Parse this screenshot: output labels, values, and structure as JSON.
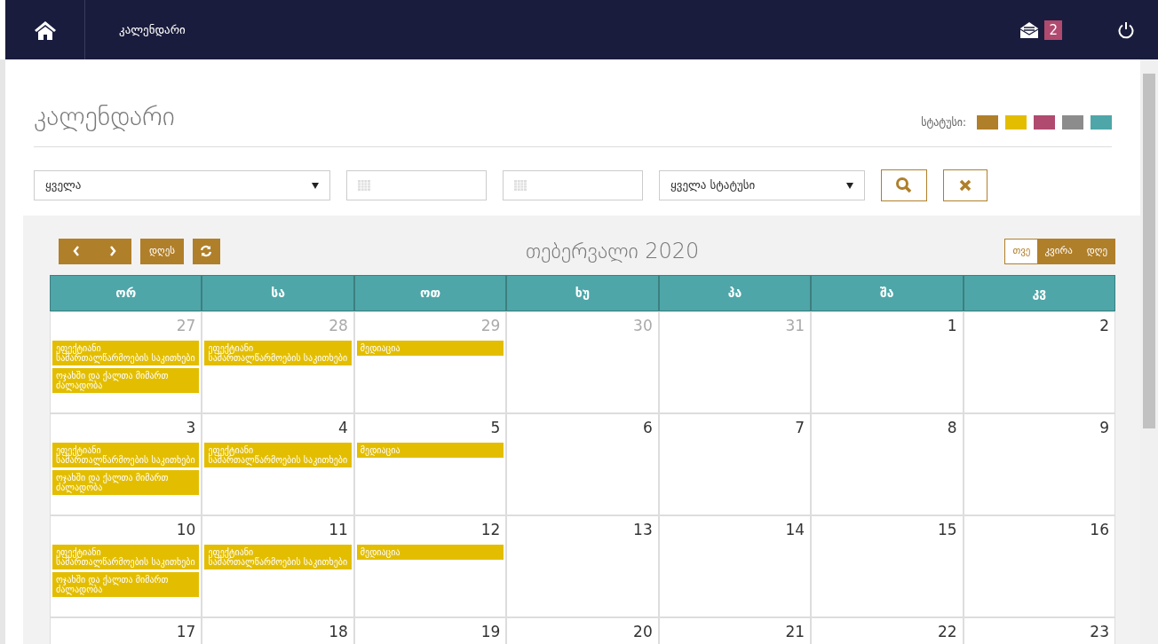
{
  "topbar": {
    "breadcrumb": "კალენდარი",
    "badge": "2"
  },
  "page_title": "კალენდარი",
  "status_legend": {
    "label": "სტატუსი:",
    "colors": [
      {
        "color": "#b07f2a"
      },
      {
        "color": "#e3be00"
      },
      {
        "color": "#b04a6e"
      },
      {
        "color": "#8c8c8c"
      },
      {
        "color": "#4ea6a8"
      }
    ]
  },
  "filters": {
    "category": "ყველა",
    "status": "ყველა სტატუსი"
  },
  "toolbar": {
    "today": "დღეს",
    "month_title": "თებერვალი 2020",
    "views": [
      {
        "label": "თვე",
        "selected": true
      },
      {
        "label": "კვირა",
        "selected": false
      },
      {
        "label": "დღე",
        "selected": false
      }
    ]
  },
  "weekdays": [
    "ორ",
    "სა",
    "ოთ",
    "ხუ",
    "პა",
    "შა",
    "კვ"
  ],
  "weeks": [
    {
      "days": [
        {
          "number": "27",
          "other_month": true,
          "events": [
            {
              "title": "ეფექტიანი სამართალწარმოების საკითხები",
              "color": "#e3be00"
            },
            {
              "title": "ოჯახში და ქალთა მიმართ ძალადობა",
              "color": "#e3be00"
            }
          ]
        },
        {
          "number": "28",
          "other_month": true,
          "events": [
            {
              "title": "ეფექტიანი სამართალწარმოების საკითხები",
              "color": "#e3be00"
            }
          ]
        },
        {
          "number": "29",
          "other_month": true,
          "events": [
            {
              "title": "მედიაცია",
              "color": "#e3be00"
            }
          ]
        },
        {
          "number": "30",
          "other_month": true
        },
        {
          "number": "31",
          "other_month": true
        },
        {
          "number": "1",
          "other_month": false
        },
        {
          "number": "2",
          "other_month": false
        }
      ]
    },
    {
      "days": [
        {
          "number": "3",
          "other_month": false,
          "events": [
            {
              "title": "ეფექტიანი სამართალწარმოების საკითხები",
              "color": "#e3be00"
            },
            {
              "title": "ოჯახში და ქალთა მიმართ ძალადობა",
              "color": "#e3be00"
            }
          ]
        },
        {
          "number": "4",
          "other_month": false,
          "events": [
            {
              "title": "ეფექტიანი სამართალწარმოების საკითხები",
              "color": "#e3be00"
            }
          ]
        },
        {
          "number": "5",
          "other_month": false,
          "events": [
            {
              "title": "მედიაცია",
              "color": "#e3be00"
            }
          ]
        },
        {
          "number": "6",
          "other_month": false
        },
        {
          "number": "7",
          "other_month": false
        },
        {
          "number": "8",
          "other_month": false
        },
        {
          "number": "9",
          "other_month": false
        }
      ]
    },
    {
      "days": [
        {
          "number": "10",
          "other_month": false,
          "events": [
            {
              "title": "ეფექტიანი სამართალწარმოების საკითხები",
              "color": "#e3be00"
            },
            {
              "title": "ოჯახში და ქალთა მიმართ ძალადობა",
              "color": "#e3be00"
            }
          ]
        },
        {
          "number": "11",
          "other_month": false,
          "events": [
            {
              "title": "ეფექტიანი სამართალწარმოების საკითხები",
              "color": "#e3be00"
            }
          ]
        },
        {
          "number": "12",
          "other_month": false,
          "events": [
            {
              "title": "მედიაცია",
              "color": "#e3be00"
            }
          ]
        },
        {
          "number": "13",
          "other_month": false
        },
        {
          "number": "14",
          "other_month": false
        },
        {
          "number": "15",
          "other_month": false
        },
        {
          "number": "16",
          "other_month": false
        }
      ]
    },
    {
      "days": [
        {
          "number": "17",
          "other_month": false
        },
        {
          "number": "18",
          "other_month": false
        },
        {
          "number": "19",
          "other_month": false
        },
        {
          "number": "20",
          "other_month": false
        },
        {
          "number": "21",
          "other_month": false
        },
        {
          "number": "22",
          "other_month": false
        },
        {
          "number": "23",
          "other_month": false
        }
      ]
    }
  ]
}
